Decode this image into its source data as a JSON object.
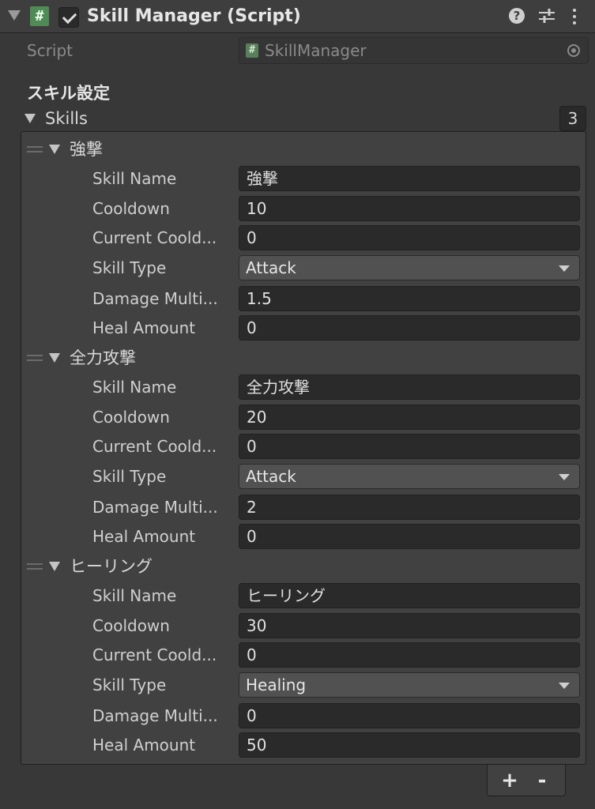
{
  "component": {
    "title": "Skill Manager (Script)",
    "script_icon": "#",
    "help_icon": "?"
  },
  "script_row": {
    "label": "Script",
    "value": "SkillManager",
    "mini_icon": "#"
  },
  "section_header": "スキル設定",
  "skills_list": {
    "label": "Skills",
    "size": "3",
    "add_label": "+",
    "remove_label": "-",
    "elements": [
      {
        "title": "強撃",
        "fields": [
          {
            "label": "Skill Name",
            "value": "強撃",
            "type": "text"
          },
          {
            "label": "Cooldown",
            "value": "10",
            "type": "text"
          },
          {
            "label": "Current Coold...",
            "value": "0",
            "type": "text"
          },
          {
            "label": "Skill Type",
            "value": "Attack",
            "type": "dropdown"
          },
          {
            "label": "Damage Multi...",
            "value": "1.5",
            "type": "text"
          },
          {
            "label": "Heal Amount",
            "value": "0",
            "type": "text"
          }
        ]
      },
      {
        "title": "全力攻撃",
        "fields": [
          {
            "label": "Skill Name",
            "value": "全力攻撃",
            "type": "text"
          },
          {
            "label": "Cooldown",
            "value": "20",
            "type": "text"
          },
          {
            "label": "Current Coold...",
            "value": "0",
            "type": "text"
          },
          {
            "label": "Skill Type",
            "value": "Attack",
            "type": "dropdown"
          },
          {
            "label": "Damage Multi...",
            "value": "2",
            "type": "text"
          },
          {
            "label": "Heal Amount",
            "value": "0",
            "type": "text"
          }
        ]
      },
      {
        "title": "ヒーリング",
        "fields": [
          {
            "label": "Skill Name",
            "value": "ヒーリング",
            "type": "text"
          },
          {
            "label": "Cooldown",
            "value": "30",
            "type": "text"
          },
          {
            "label": "Current Coold...",
            "value": "0",
            "type": "text"
          },
          {
            "label": "Skill Type",
            "value": "Healing",
            "type": "dropdown"
          },
          {
            "label": "Damage Multi...",
            "value": "0",
            "type": "text"
          },
          {
            "label": "Heal Amount",
            "value": "50",
            "type": "text"
          }
        ]
      }
    ]
  },
  "colors": {
    "background": "#383838",
    "header": "#3e3e3e",
    "field": "#2a2a2a",
    "dropdown": "#515151",
    "script_green": "#4f8a57"
  }
}
